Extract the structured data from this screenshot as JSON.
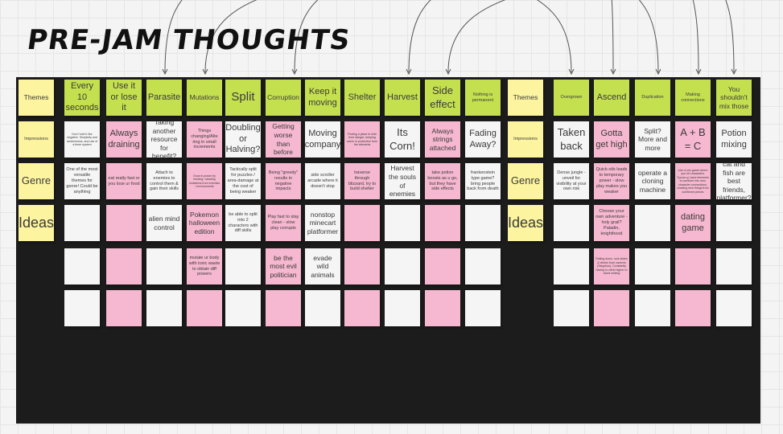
{
  "title": "PRE-JAM THOUGHTS",
  "colors": {
    "yellow": "#fdf4a0",
    "green": "#c5e04f",
    "pink": "#f6b8d0",
    "white": "#f5f5f5",
    "board": "#1c1c1c"
  },
  "row_labels": {
    "left": [
      "Themes",
      "Impressions",
      "Genre",
      "Ideas"
    ],
    "right": [
      "Themes",
      "Impressions",
      "Genre",
      "Ideas"
    ]
  },
  "columns": [
    {
      "theme": "Every 10 seconds",
      "impression": "Don't hold it like negative. Simplicity and randomness, and use of a timer system",
      "genre": "One of the most versatile themes for genre! Could be anything",
      "ideas": [
        "",
        "",
        ""
      ]
    },
    {
      "theme": "Use it or lose it",
      "impression": "Always draining",
      "genre": "eat really fast or you lose ur food",
      "ideas": [
        "",
        "",
        ""
      ]
    },
    {
      "theme": "Parasite",
      "impression": "Taking another resource for benefit?",
      "genre": "Attach to enemies to control them & gain their skills",
      "ideas": [
        "alien mind control",
        "",
        ""
      ]
    },
    {
      "theme": "Mutations",
      "impression": "Things changing/Alte ring in small increments",
      "genre": "Grow in power by feeding / stealing mutations from enemies / environments",
      "ideas": [
        "Pokemon halloween edition",
        "mutate ur body with toxic waste to obtain diff powers",
        ""
      ]
    },
    {
      "theme": "Split",
      "impression": "Doubling or Halving?",
      "genre": "Tactically split for puzzles / area-damage at the cost of being weaker",
      "ideas": [
        "be able to split into 2 characters with diff skills",
        "",
        ""
      ]
    },
    {
      "theme": "Corruption",
      "impression": "Getting worse than before",
      "genre": "Being \"greedy\" results in negative impacts",
      "ideas": [
        "Play fast to stay clean - slow play corrupts",
        "be the most evil politician",
        ""
      ]
    },
    {
      "theme": "Keep it moving",
      "impression": "Moving company",
      "genre": "side scroller arcade where it doesn't stop",
      "ideas": [
        "nonstop minecart platformer",
        "evade wild animals",
        ""
      ]
    },
    {
      "theme": "Shelter",
      "impression": "Finding a place to hide from danger, keeping warm or protection from the elements",
      "genre": "traverse through blizzard, try to build shelter",
      "ideas": [
        "",
        "",
        ""
      ]
    },
    {
      "theme": "Harvest",
      "impression": "Its Corn!",
      "genre": "Harvest the souls of enemies",
      "ideas": [
        "",
        "",
        ""
      ]
    },
    {
      "theme": "Side effect",
      "impression": "Always strings attached",
      "genre": "take potion boosts as u go, but they have side effects",
      "ideas": [
        "",
        "",
        ""
      ]
    },
    {
      "theme": "Nothing is permanent",
      "impression": "Fading Away?",
      "genre": "frankenstein type game? bring people back from death",
      "ideas": [
        "",
        "",
        ""
      ]
    },
    {
      "theme": "Overgrown",
      "impression": "Taken back",
      "genre": "Dense jungle - unveil for visibility at your own risk",
      "ideas": [
        "",
        "",
        ""
      ]
    },
    {
      "theme": "Ascend",
      "impression": "Gotta get high",
      "genre": "Quick-oils leads to temporary power - slow play makes you weaker",
      "ideas": [
        "Choose your own adventure - holy grail? Paladin, knighthood",
        "Rolling down, rock slides & climbs from caverns (Sisyphus). Constantly having to climb higher to avoid sinking",
        ""
      ]
    },
    {
      "theme": "Duplication",
      "impression": "Split? More and more",
      "genre": "operate a cloning machine",
      "ideas": [
        "",
        "",
        ""
      ]
    },
    {
      "theme": "Making connections",
      "impression": "A + B = C",
      "genre": "Like a sim game where you hit characters. Tycoon-y, hand elements to combine into new, character connections, creating new things from combined pieces",
      "ideas": [
        "dating game",
        "",
        ""
      ]
    },
    {
      "theme": "You shouldn't mix those",
      "impression": "Potion mixing",
      "genre": "cat and fish are best friends, platformer?",
      "ideas": [
        "",
        "",
        ""
      ]
    }
  ]
}
